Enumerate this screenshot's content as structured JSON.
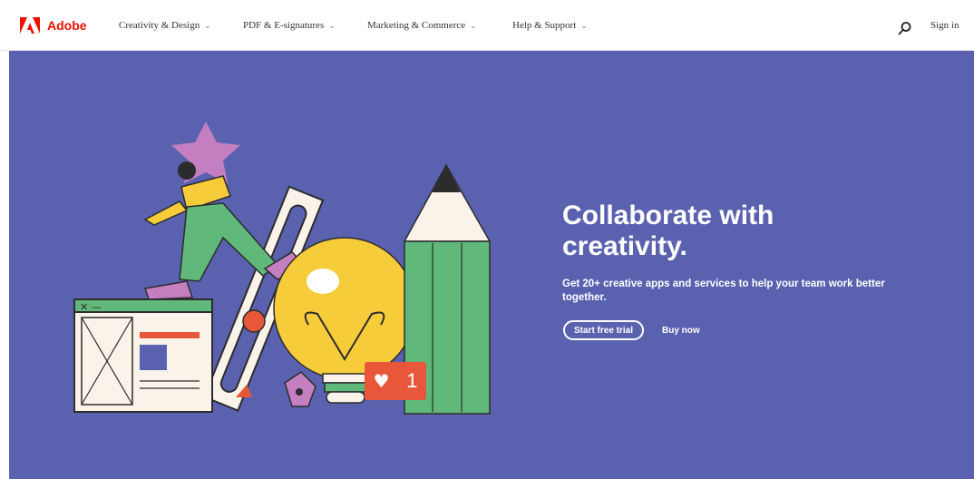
{
  "nav": {
    "brand": "Adobe",
    "items": [
      {
        "label": "Creativity & Design"
      },
      {
        "label": "PDF & E-signatures"
      },
      {
        "label": "Marketing & Commerce"
      },
      {
        "label": "Help & Support"
      }
    ],
    "signin": "Sign in"
  },
  "hero": {
    "headline": "Collaborate with creativity.",
    "subtext": "Get 20+ creative apps and services to help your team work better together.",
    "primary_cta": "Start free trial",
    "secondary_cta": "Buy now",
    "notification_count": "1"
  },
  "colors": {
    "brand_red": "#eb1000",
    "hero_bg": "#5a62b0"
  }
}
